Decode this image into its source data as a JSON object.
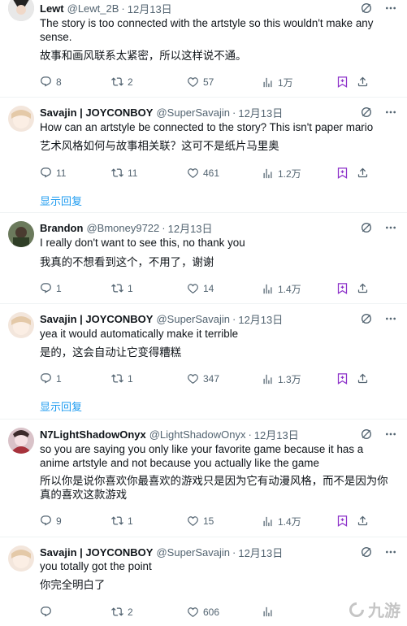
{
  "colors": {
    "accent": "#1d9bf0",
    "bookmark": "#8b2fc9",
    "muted": "#536471"
  },
  "tweets": [
    {
      "name": "Lewt",
      "handle": "@Lewt_2B",
      "time": "12月13日",
      "text_en": "The story is too connected with the artstyle so this wouldn't make any sense.",
      "text_zh": "故事和画风联系太紧密，所以这样说不通。",
      "replies": "8",
      "reposts": "2",
      "likes": "57",
      "views": "1万"
    },
    {
      "name": "Savajin | JOYCONBOY",
      "handle": "@SuperSavajin",
      "time": "12月13日",
      "text_en": "How can an artstyle be connected to the story? This isn't paper mario",
      "text_zh": "艺术风格如何与故事相关联？这可不是纸片马里奥",
      "replies": "11",
      "reposts": "11",
      "likes": "461",
      "views": "1.2万",
      "show_replies": "显示回复"
    },
    {
      "name": "Brandon",
      "handle": "@Bmoney9722",
      "time": "12月13日",
      "text_en": "I really don't want to see this, no thank you",
      "text_zh": "我真的不想看到这个，不用了，谢谢",
      "replies": "1",
      "reposts": "1",
      "likes": "14",
      "views": "1.4万"
    },
    {
      "name": "Savajin | JOYCONBOY",
      "handle": "@SuperSavajin",
      "time": "12月13日",
      "text_en": "yea it would automatically make it terrible",
      "text_zh": "是的，这会自动让它变得糟糕",
      "replies": "1",
      "reposts": "1",
      "likes": "347",
      "views": "1.3万",
      "show_replies": "显示回复"
    },
    {
      "name": "N7LightShadowOnyx",
      "handle": "@LightShadowOnyx",
      "time": "12月13日",
      "text_en": "so you are saying you only like your favorite game because it has a anime artstyle and not because you actually like the game",
      "text_zh": "所以你是说你喜欢你最喜欢的游戏只是因为它有动漫风格，而不是因为你真的喜欢这款游戏",
      "replies": "9",
      "reposts": "1",
      "likes": "15",
      "views": "1.4万"
    },
    {
      "name": "Savajin | JOYCONBOY",
      "handle": "@SuperSavajin",
      "time": "12月13日",
      "text_en": "you totally got the point",
      "text_zh": "你完全明白了",
      "replies": "",
      "reposts": "2",
      "likes": "606",
      "views": ""
    }
  ],
  "watermark": {
    "text": "九游"
  }
}
